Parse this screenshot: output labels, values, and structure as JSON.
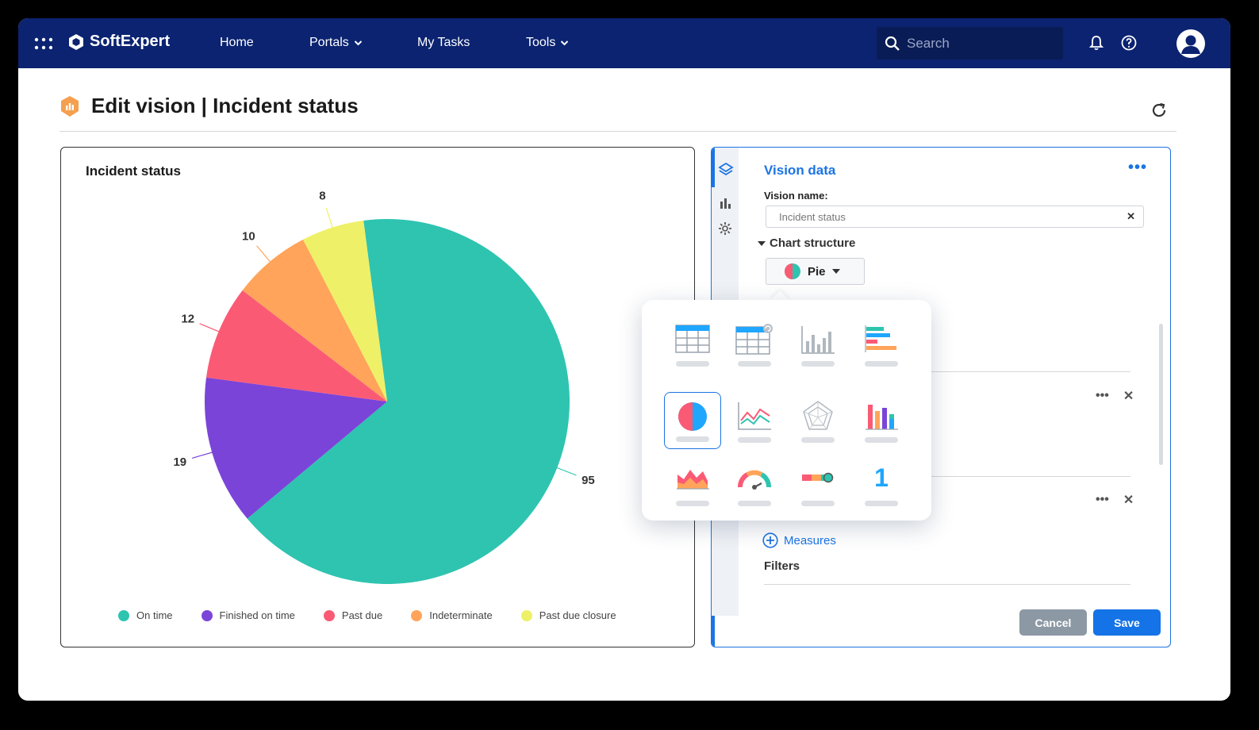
{
  "topbar": {
    "brand": "SoftExpert",
    "nav": [
      {
        "label": "Home",
        "has_dropdown": false
      },
      {
        "label": "Portals",
        "has_dropdown": true
      },
      {
        "label": "My Tasks",
        "has_dropdown": false
      },
      {
        "label": "Tools",
        "has_dropdown": true
      }
    ],
    "search_placeholder": "Search",
    "icons": [
      "apps-grid-icon",
      "bell-icon",
      "help-icon",
      "user-avatar-icon"
    ]
  },
  "page": {
    "title": "Edit vision | Incident status",
    "title_icon": "chart-badge-icon"
  },
  "chart_card": {
    "title": "Incident status"
  },
  "chart_data": {
    "type": "pie",
    "title": "Incident status",
    "categories": [
      "On time",
      "Finished on time",
      "Past due",
      "Indeterminate",
      "Past due closure"
    ],
    "values": [
      95,
      19,
      12,
      10,
      8
    ],
    "colors": [
      "#2ec4b0",
      "#7b44d8",
      "#fb5a75",
      "#ffa45a",
      "#eef067"
    ],
    "legend_position": "bottom"
  },
  "side_panel": {
    "title": "Vision data",
    "vision_name_label": "Vision name:",
    "vision_name_value": "Incident status",
    "chart_structure_label": "Chart structure",
    "chart_type_selected": "Pie",
    "measures_label": "Measures",
    "filters_label": "Filters",
    "cancel_label": "Cancel",
    "save_label": "Save",
    "rail_icons": [
      "layers-icon",
      "bar-chart-icon",
      "gear-icon"
    ]
  },
  "chart_types": [
    "table",
    "pivot-table",
    "column",
    "bar",
    "pie",
    "line",
    "radar",
    "stacked-column",
    "area",
    "gauge",
    "progress",
    "number"
  ],
  "number_tile_glyph": "1",
  "colors": {
    "topbar": "#0b2370",
    "accent": "#1b74e4"
  }
}
